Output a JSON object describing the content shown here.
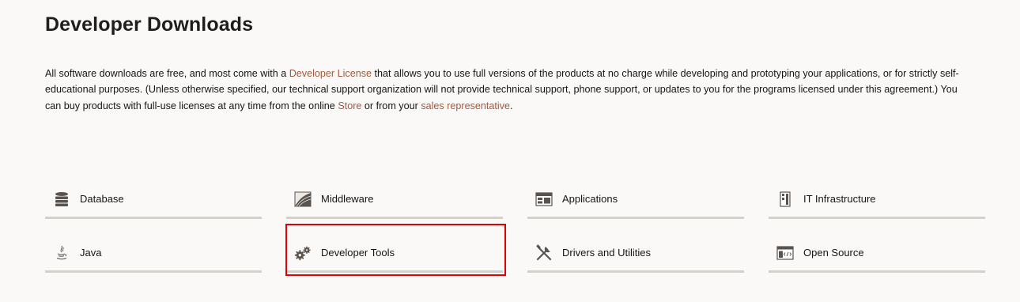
{
  "page": {
    "title": "Developer Downloads",
    "intro": {
      "part1": "All software downloads are free, and most come with a ",
      "link_license": "Developer License",
      "part2": " that allows you to use full versions of the products at no charge while developing and prototyping your applications, or for strictly self-educational purposes. (Unless otherwise specified, our technical support organization will not provide technical support, phone support, or updates to you for the programs licensed under this agreement.) You can buy products with full-use licenses at any time from the online ",
      "link_store": "Store",
      "part3": " or from your ",
      "link_sales": "sales representative",
      "part4": "."
    }
  },
  "categories": [
    {
      "label": "Database",
      "icon": "database-icon"
    },
    {
      "label": "Middleware",
      "icon": "middleware-icon"
    },
    {
      "label": "Applications",
      "icon": "applications-icon"
    },
    {
      "label": "IT Infrastructure",
      "icon": "server-icon"
    },
    {
      "label": "Java",
      "icon": "java-icon"
    },
    {
      "label": "Developer Tools",
      "icon": "gears-icon"
    },
    {
      "label": "Drivers and Utilities",
      "icon": "tools-icon"
    },
    {
      "label": "Open Source",
      "icon": "code-window-icon"
    }
  ],
  "colors": {
    "link": "#a1583c",
    "divider": "#d4d1cc",
    "highlight": "#e00000",
    "background": "#fbf9f8"
  }
}
